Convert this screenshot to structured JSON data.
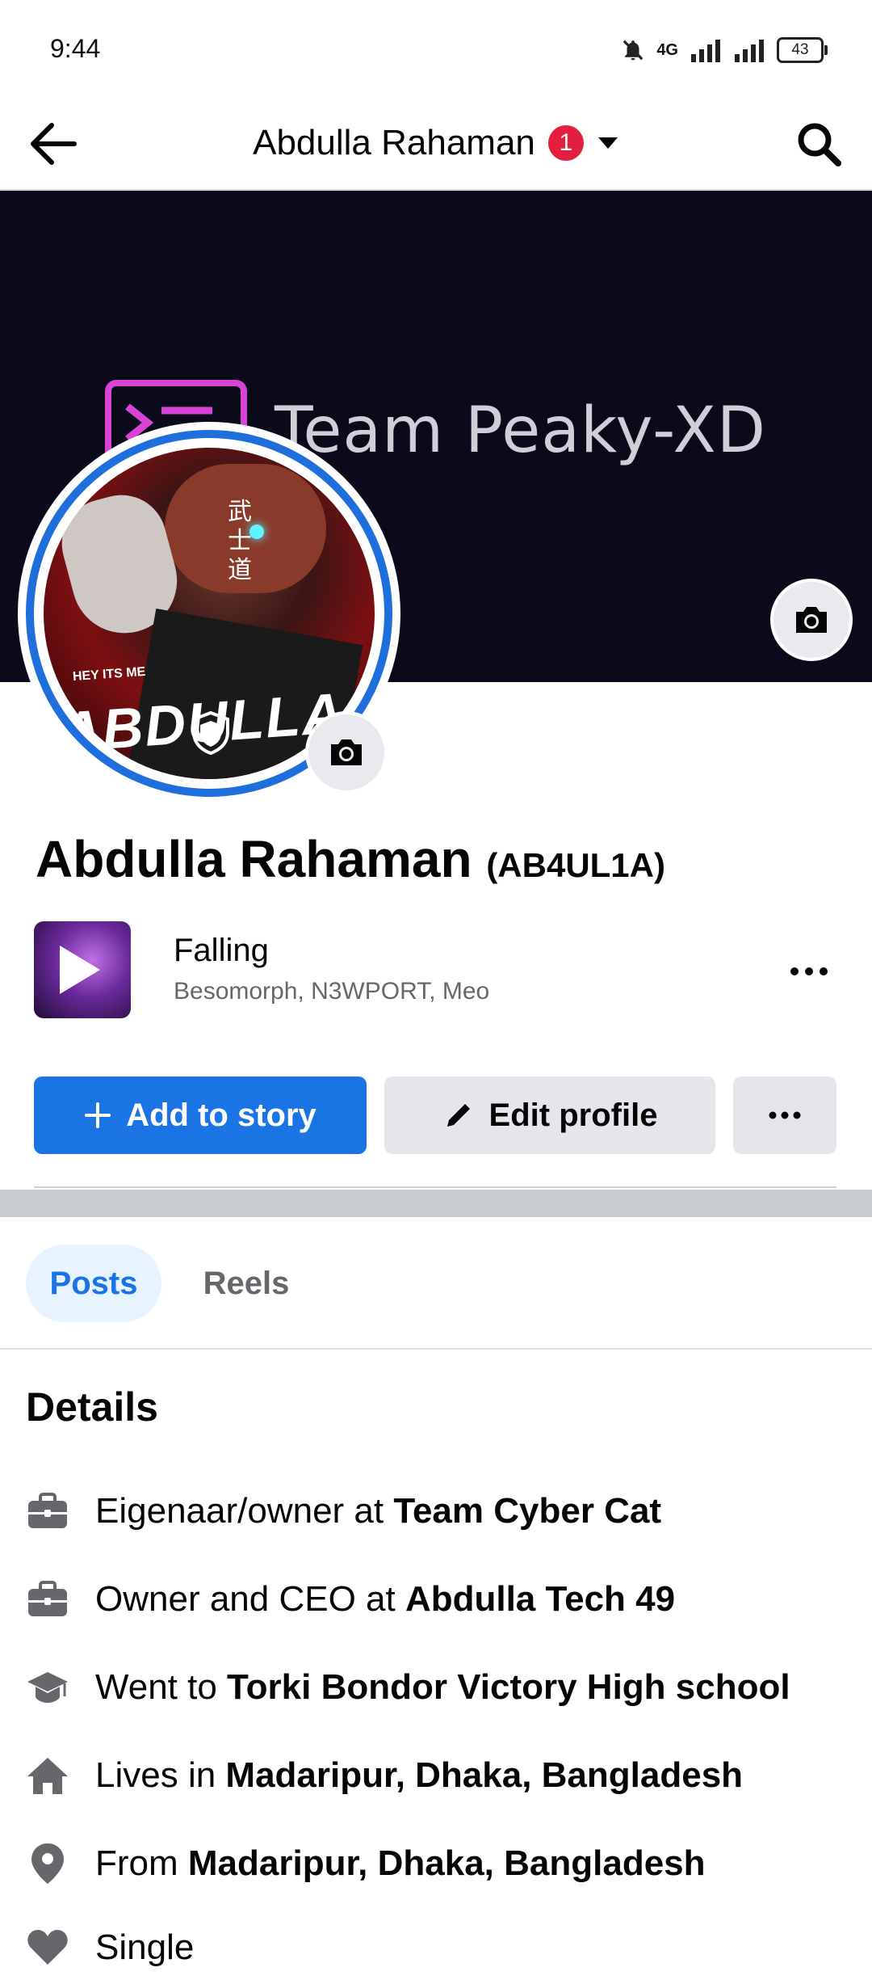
{
  "status_bar": {
    "time": "9:44",
    "network": "4G",
    "battery": "43"
  },
  "top_nav": {
    "title": "Abdulla Rahaman",
    "badge_count": "1"
  },
  "cover": {
    "text": "Team Peaky-XD"
  },
  "avatar": {
    "small_text": "HEY ITS ME",
    "name_text": "ABDULLA",
    "kanji": "武士道"
  },
  "profile": {
    "name": "Abdulla Rahaman",
    "alternate_name": "(AB4UL1A)"
  },
  "music": {
    "title": "Falling",
    "artist": "Besomorph, N3WPORT, Meo"
  },
  "actions": {
    "add_story": "Add to story",
    "edit_profile": "Edit profile"
  },
  "tabs": [
    {
      "label": "Posts",
      "active": true
    },
    {
      "label": "Reels",
      "active": false
    }
  ],
  "details": {
    "heading": "Details",
    "items": [
      {
        "icon": "briefcase-icon",
        "prefix": "Eigenaar/owner at ",
        "value": "Team Cyber Cat"
      },
      {
        "icon": "briefcase-icon",
        "prefix": "Owner and CEO at ",
        "value": "Abdulla Tech 49"
      },
      {
        "icon": "graduation-cap-icon",
        "prefix": "Went to ",
        "value": "Torki Bondor Victory High school"
      },
      {
        "icon": "home-icon",
        "prefix": "Lives in ",
        "value": "Madaripur, Dhaka, Bangladesh"
      },
      {
        "icon": "location-pin-icon",
        "prefix": "From ",
        "value": "Madaripur, Dhaka, Bangladesh"
      },
      {
        "icon": "heart-icon",
        "prefix": "Single",
        "value": ""
      }
    ]
  },
  "colors": {
    "accent": "#1b74e4",
    "badge": "#e41e3f",
    "button_gray": "#e4e6eb",
    "cover_bg": "#0b0a1a"
  }
}
